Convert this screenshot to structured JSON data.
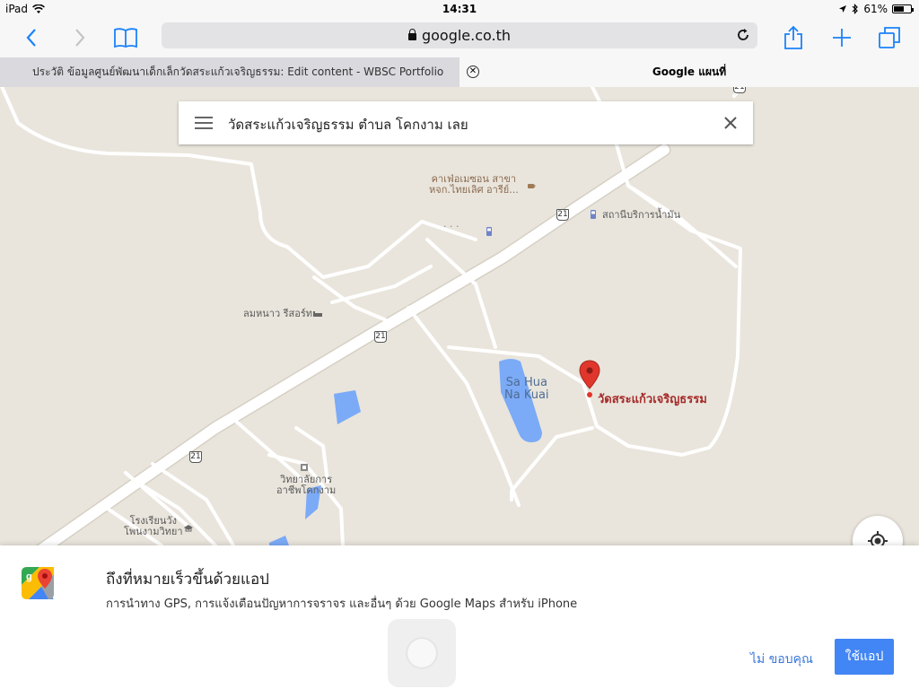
{
  "status_bar": {
    "device": "iPad",
    "time": "14:31",
    "battery": "61%",
    "battery_level": 0.61
  },
  "toolbar": {
    "url": "google.co.th",
    "icons": [
      "back-icon",
      "forward-icon",
      "bookmarks-icon",
      "lock-icon",
      "reload-icon",
      "share-icon",
      "plus-icon",
      "tabs-icon"
    ]
  },
  "tabs": [
    {
      "label": "ประวัติ ข้อมูลศูนย์พัฒนาเด็กเล็กวัดสระแก้วเจริญธรรม: Edit content - WBSC Portfolio",
      "active": false
    },
    {
      "label": "Google แผนที่",
      "active": true
    }
  ],
  "search": {
    "query": "วัดสระแก้วเจริญธรรม ตำบล โคกงาม เลย"
  },
  "map": {
    "pin_label": "วัดสระแก้วเจริญธรรม",
    "lake_label_1": "Sa Hua",
    "lake_label_2": "Na Kuai",
    "cafe_1": "คาเฟ่อเมซอน สาขา",
    "cafe_2": "หจก.ไทยเลิศ อารีย์...",
    "gas_station": "สถานีบริการน้ำมัน",
    "resort": "ลมหนาว รีสอร์ท",
    "college_1": "วิทยาลัยการ",
    "college_2": "อาชีพโคกงาม",
    "school_1": "โรงเรียนวัง",
    "school_2": "โพนงามวิทยา",
    "road_shield": "21",
    "dots": "· · ·",
    "colors": {
      "land": "#e9e5dc",
      "road": "#ffffff",
      "water": "#7baaf7",
      "pin": "#e0362c",
      "pin_label": "#a52a2a"
    }
  },
  "banner": {
    "title": "ถึงที่หมายเร็วขึ้นด้วยแอป",
    "subtitle": "การนำทาง GPS, การแจ้งเตือนปัญหาการจราจร และอื่นๆ ด้วย Google Maps สำหรับ iPhone",
    "no_thanks": "ไม่ ขอบคุณ",
    "use_app": "ใช้แอป",
    "accent": "#4285f4"
  }
}
